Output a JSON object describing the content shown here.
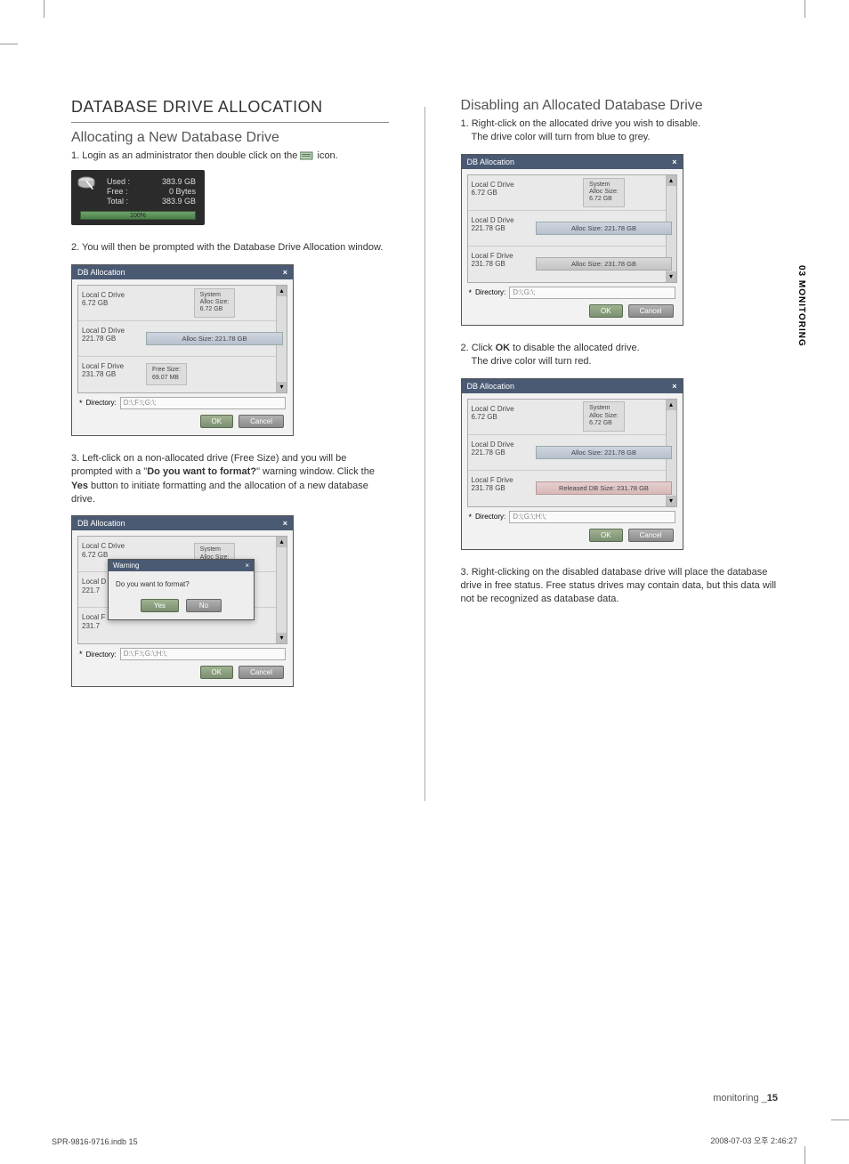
{
  "left": {
    "heading": "DATABASE DRIVE ALLOCATION",
    "sub1": "Allocating a New Database Drive",
    "step1_prefix": "1. Login as an administrator then double click on the ",
    "step1_suffix": " icon.",
    "disk": {
      "used_label": "Used :",
      "used_val": "383.9 GB",
      "free_label": "Free :",
      "free_val": "0 Bytes",
      "total_label": "Total :",
      "total_val": "383.9 GB",
      "pct": "100%"
    },
    "step2": "2. You will then be prompted with the Database Drive Allocation window.",
    "win1": {
      "title": "DB Allocation",
      "drives": [
        {
          "name": "Local C Drive",
          "size": "6.72 GB",
          "info_type": "sys",
          "l1": "System",
          "l2": "Alloc Size:",
          "l3": "6.72 GB"
        },
        {
          "name": "Local D Drive",
          "size": "221.78 GB",
          "info_type": "alloc",
          "text": "Alloc Size: 221.78 GB"
        },
        {
          "name": "Local F Drive",
          "size": "231.78 GB",
          "info_type": "free",
          "l1": "Free Size:",
          "l2": "69.07 MB"
        }
      ],
      "dir_label": "Directory:",
      "dir_path": "D:\\;F:\\;G:\\;",
      "ok": "OK",
      "cancel": "Cancel"
    },
    "step3_a": "3. Left-click on a non-allocated drive (Free Size) and you will be prompted with a \"",
    "step3_b": "Do you want to format?",
    "step3_c": "\" warning window. Click the ",
    "step3_d": "Yes",
    "step3_e": " button to initiate formatting and the allocation of a new database drive.",
    "win2": {
      "title": "DB Allocation",
      "drives": [
        {
          "name": "Local C Drive",
          "size": "6.72 GB",
          "info_type": "sys",
          "l1": "System",
          "l2": "Alloc Size:"
        },
        {
          "name": "Local D",
          "size": "221.7"
        },
        {
          "name": "Local F",
          "size": "231.7"
        }
      ],
      "warn_title": "Warning",
      "warn_text": "Do you want to format?",
      "yes": "Yes",
      "no": "No",
      "dir_label": "Directory:",
      "dir_path": "D:\\;F:\\;G:\\;H:\\;",
      "ok": "OK",
      "cancel": "Cancel"
    }
  },
  "right": {
    "sub": "Disabling an Allocated Database Drive",
    "step1_a": "1. Right-click on the allocated drive you wish to disable.",
    "step1_b": "The drive color will turn from blue to grey.",
    "win1": {
      "title": "DB Allocation",
      "drives": [
        {
          "name": "Local C Drive",
          "size": "6.72 GB",
          "info_type": "sys",
          "l1": "System",
          "l2": "Alloc Size:",
          "l3": "6.72 GB"
        },
        {
          "name": "Local D Drive",
          "size": "221.78 GB",
          "info_type": "alloc",
          "text": "Alloc Size: 221.78 GB"
        },
        {
          "name": "Local F Drive",
          "size": "231.78 GB",
          "info_type": "alloc",
          "text": "Alloc Size: 231.78 GB"
        }
      ],
      "dir_label": "Directory:",
      "dir_path": "D:\\;G:\\;",
      "ok": "OK",
      "cancel": "Cancel"
    },
    "step2_a": "2. Click ",
    "step2_b": "OK",
    "step2_c": " to disable the allocated drive.",
    "step2_d": "The drive color will turn red.",
    "win2": {
      "title": "DB Allocation",
      "drives": [
        {
          "name": "Local C Drive",
          "size": "6.72 GB",
          "info_type": "sys",
          "l1": "System",
          "l2": "Alloc Size:",
          "l3": "6.72 GB"
        },
        {
          "name": "Local D Drive",
          "size": "221.78 GB",
          "info_type": "alloc",
          "text": "Alloc Size: 221.78 GB"
        },
        {
          "name": "Local F Drive",
          "size": "231.78 GB",
          "info_type": "released",
          "text": "Released DB Size: 231.78 GB"
        }
      ],
      "dir_label": "Directory:",
      "dir_path": "D:\\;G:\\;H:\\;",
      "ok": "OK",
      "cancel": "Cancel"
    },
    "step3": "3. Right-clicking on the disabled database drive will place the database drive in free status. Free status drives may contain data, but this data will not be recognized as database data."
  },
  "sidetab": "03 MONITORING",
  "footer_right_a": "monitoring _",
  "footer_right_b": "15",
  "print_l": "SPR-9816-9716.indb   15",
  "print_r": "2008-07-03   오후 2:46:27"
}
